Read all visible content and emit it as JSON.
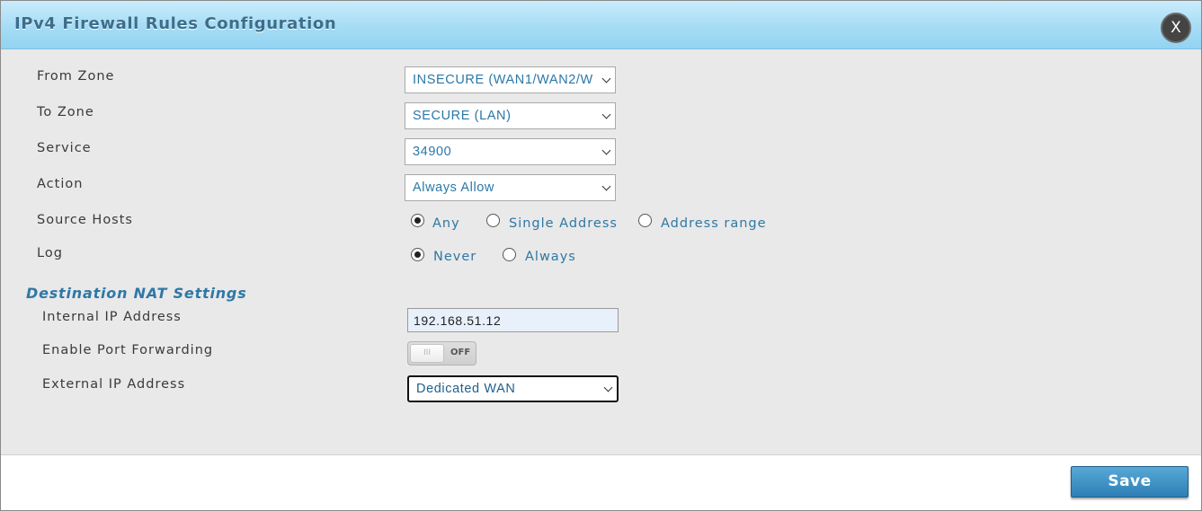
{
  "dialog": {
    "title": "IPv4 Firewall Rules Configuration",
    "close_label": "X"
  },
  "form": {
    "from_zone": {
      "label": "From Zone",
      "value": "INSECURE (WAN1/WAN2/W"
    },
    "to_zone": {
      "label": "To Zone",
      "value": "SECURE (LAN)"
    },
    "service": {
      "label": "Service",
      "value": "34900"
    },
    "action": {
      "label": "Action",
      "value": "Always Allow"
    },
    "source_hosts": {
      "label": "Source Hosts",
      "options": [
        "Any",
        "Single Address",
        "Address range"
      ],
      "selected": "Any"
    },
    "log": {
      "label": "Log",
      "options": [
        "Never",
        "Always"
      ],
      "selected": "Never"
    }
  },
  "nat": {
    "section_title": "Destination NAT Settings",
    "internal_ip": {
      "label": "Internal IP Address",
      "value": "192.168.51.12"
    },
    "port_forwarding": {
      "label": "Enable Port Forwarding",
      "state": "OFF",
      "knob": "III"
    },
    "external_ip": {
      "label": "External IP Address",
      "value": "Dedicated WAN"
    }
  },
  "footer": {
    "save_label": "Save"
  },
  "colors": {
    "title_bar": "#a6dcf5",
    "accent_text": "#2f78a6",
    "save_button": "#2d7fb6"
  }
}
